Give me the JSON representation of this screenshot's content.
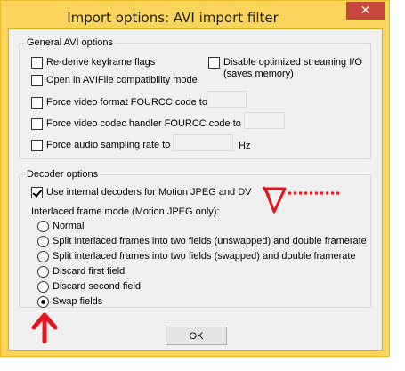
{
  "window": {
    "title": "Import options: AVI import filter",
    "close_glyph": "✕"
  },
  "general": {
    "title": "General AVI options",
    "rederive": {
      "label": "Re-derive keyframe flags",
      "checked": false
    },
    "disable_streaming": {
      "label_line1": "Disable optimized streaming I/O",
      "label_line2": "(saves memory)",
      "checked": false
    },
    "open_compat": {
      "label": "Open in AVIFile compatibility mode",
      "checked": false
    },
    "force_video_format": {
      "label": "Force video format FOURCC code to",
      "checked": false,
      "value": ""
    },
    "force_codec_handler": {
      "label": "Force video codec handler FOURCC code to",
      "checked": false,
      "value": ""
    },
    "force_audio_rate": {
      "label": "Force audio sampling rate to",
      "checked": false,
      "value": "",
      "unit": "Hz"
    }
  },
  "decoder": {
    "title": "Decoder options",
    "use_internal": {
      "label": "Use internal decoders for Motion JPEG and DV",
      "checked": true
    },
    "interlaced_label": "Interlaced frame mode (Motion JPEG only):",
    "modes": [
      {
        "label": "Normal",
        "selected": false
      },
      {
        "label": "Split interlaced frames into two fields (unswapped) and double framerate",
        "selected": false
      },
      {
        "label": "Split interlaced frames into two fields (swapped) and double framerate",
        "selected": false
      },
      {
        "label": "Discard first field",
        "selected": false
      },
      {
        "label": "Discard second field",
        "selected": false
      },
      {
        "label": "Swap fields",
        "selected": true
      }
    ]
  },
  "ok_label": "OK",
  "colors": {
    "annotation": "#e8141b",
    "frame": "#fbd45c",
    "close": "#c7463c"
  }
}
